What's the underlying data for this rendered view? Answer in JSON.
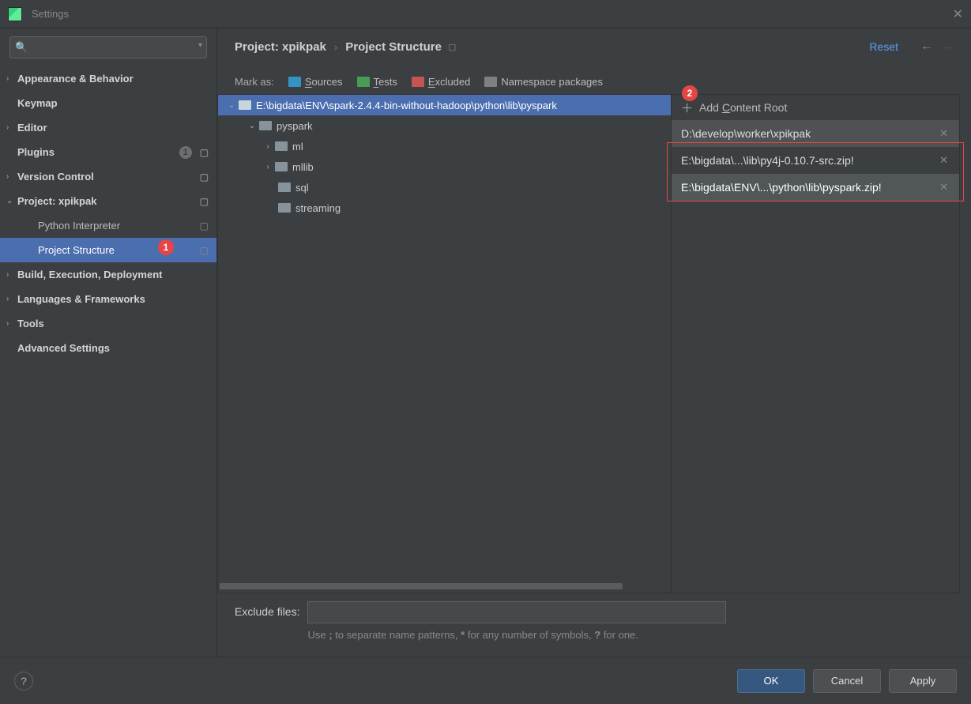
{
  "window": {
    "title": "Settings"
  },
  "sidebar": {
    "items": [
      {
        "label": "Appearance & Behavior",
        "bold": true,
        "chev": true
      },
      {
        "label": "Keymap",
        "bold": true
      },
      {
        "label": "Editor",
        "bold": true,
        "chev": true
      },
      {
        "label": "Plugins",
        "bold": true,
        "badge": "1",
        "cfg": true
      },
      {
        "label": "Version Control",
        "bold": true,
        "chev": true,
        "cfg": true
      },
      {
        "label": "Project: xpikpak",
        "bold": true,
        "chev": true,
        "open": true,
        "cfg": true
      },
      {
        "label": "Python Interpreter",
        "sub": true,
        "cfg": true
      },
      {
        "label": "Project Structure",
        "sub": true,
        "selected": true,
        "cfg": true,
        "red": "1"
      },
      {
        "label": "Build, Execution, Deployment",
        "bold": true,
        "chev": true
      },
      {
        "label": "Languages & Frameworks",
        "bold": true,
        "chev": true
      },
      {
        "label": "Tools",
        "bold": true,
        "chev": true
      },
      {
        "label": "Advanced Settings",
        "bold": true
      }
    ]
  },
  "breadcrumb": {
    "a": "Project: xpikpak",
    "b": "Project Structure",
    "reset": "Reset"
  },
  "mark": {
    "label": "Mark as:",
    "sources": "Sources",
    "tests": "Tests",
    "excluded": "Excluded",
    "namespace": "Namespace packages"
  },
  "tree": {
    "root": "E:\\bigdata\\ENV\\spark-2.4.4-bin-without-hadoop\\python\\lib\\pyspark",
    "n1": "pyspark",
    "n2": "ml",
    "n3": "mllib",
    "n4": "sql",
    "n5": "streaming"
  },
  "roots": {
    "add": "Add Content Root",
    "r0": "D:\\develop\\worker\\xpikpak",
    "r1": "E:\\bigdata\\...\\lib\\py4j-0.10.7-src.zip!",
    "r2": "E:\\bigdata\\ENV\\...\\python\\lib\\pyspark.zip!",
    "badge": "2"
  },
  "exclude": {
    "label": "Exclude files:",
    "hint": "Use ; to separate name patterns, * for any number of symbols, ? for one."
  },
  "buttons": {
    "ok": "OK",
    "cancel": "Cancel",
    "apply": "Apply",
    "help": "?"
  }
}
